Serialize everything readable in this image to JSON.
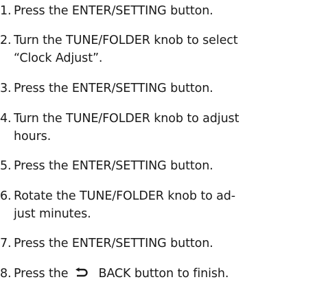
{
  "steps": [
    {
      "num": "1.",
      "text": "Press the ENTER/SETTING button."
    },
    {
      "num": "2.",
      "line1": "Turn the TUNE/FOLDER knob to select",
      "line2": "“Clock Adjust”."
    },
    {
      "num": "3.",
      "text": "Press the ENTER/SETTING button."
    },
    {
      "num": "4.",
      "line1": "Turn the TUNE/FOLDER knob to adjust",
      "line2": "hours."
    },
    {
      "num": "5.",
      "text": "Press the ENTER/SETTING button."
    },
    {
      "num": "6.",
      "line1": "Rotate the TUNE/FOLDER knob to ad-",
      "line2": "just minutes."
    },
    {
      "num": "7.",
      "text": "Press the ENTER/SETTING button."
    },
    {
      "num": "8.",
      "pre": "Press the",
      "icon": "back-arrow-icon",
      "post": "BACK button to finish."
    }
  ]
}
